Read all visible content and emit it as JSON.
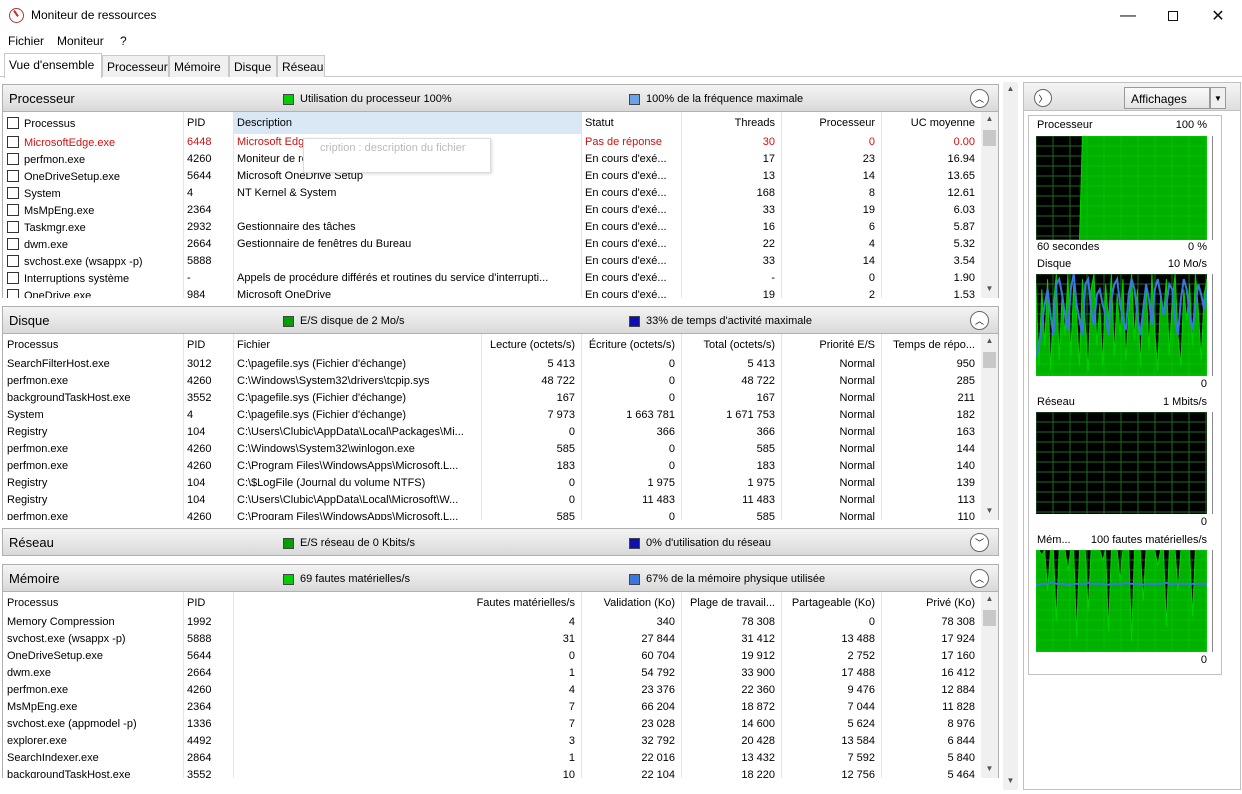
{
  "window": {
    "title": "Moniteur de ressources",
    "minimize": "—",
    "close": "✕"
  },
  "menu": [
    "Fichier",
    "Moniteur",
    "?"
  ],
  "tabs": [
    "Vue d'ensemble",
    "Processeur",
    "Mémoire",
    "Disque",
    "Réseau"
  ],
  "colors": {
    "green": "#00d000",
    "blue": "#3a78e0",
    "darkblue": "#1010b0",
    "graph_bg": "#000000",
    "graph_grid": "#1f6b1f"
  },
  "processeur": {
    "title": "Processeur",
    "ind1": "Utilisation du processeur 100%",
    "ind2": "100% de la fréquence maximale",
    "columns": [
      "Processus",
      "PID",
      "Description",
      "Statut",
      "Threads",
      "Processeur",
      "UC moyenne"
    ],
    "tooltip": "cription : description du fichier",
    "rows": [
      [
        "MicrosoftEdge.exe",
        "6448",
        "Microsoft Edge",
        "Pas de réponse",
        "30",
        "0",
        "0.00"
      ],
      [
        "perfmon.exe",
        "4260",
        "Moniteur de ressources et de performances",
        "En cours d'exé...",
        "17",
        "23",
        "16.94"
      ],
      [
        "OneDriveSetup.exe",
        "5644",
        "Microsoft OneDrive Setup",
        "En cours d'exé...",
        "13",
        "14",
        "13.65"
      ],
      [
        "System",
        "4",
        "NT Kernel & System",
        "En cours d'exé...",
        "168",
        "8",
        "12.61"
      ],
      [
        "MsMpEng.exe",
        "2364",
        "",
        "En cours d'exé...",
        "33",
        "19",
        "6.03"
      ],
      [
        "Taskmgr.exe",
        "2932",
        "Gestionnaire des tâches",
        "En cours d'exé...",
        "16",
        "6",
        "5.87"
      ],
      [
        "dwm.exe",
        "2664",
        "Gestionnaire de fenêtres du Bureau",
        "En cours d'exé...",
        "22",
        "4",
        "5.32"
      ],
      [
        "svchost.exe (wsappx -p)",
        "5888",
        "",
        "En cours d'exé...",
        "33",
        "14",
        "3.54"
      ],
      [
        "Interruptions système",
        "-",
        "Appels de procédure différés et routines du service d'interrupti...",
        "En cours d'exé...",
        "-",
        "0",
        "1.90"
      ],
      [
        "OneDrive.exe",
        "984",
        "Microsoft OneDrive",
        "En cours d'exé...",
        "19",
        "2",
        "1.53"
      ]
    ]
  },
  "disque": {
    "title": "Disque",
    "ind1": "E/S disque de 2 Mo/s",
    "ind2": "33% de temps d'activité maximale",
    "columns": [
      "Processus",
      "PID",
      "Fichier",
      "Lecture (octets/s)",
      "Écriture (octets/s)",
      "Total (octets/s)",
      "Priorité E/S",
      "Temps de répo..."
    ],
    "rows": [
      [
        "SearchFilterHost.exe",
        "3012",
        "C:\\pagefile.sys (Fichier d'échange)",
        "5 413",
        "0",
        "5 413",
        "Normal",
        "950"
      ],
      [
        "perfmon.exe",
        "4260",
        "C:\\Windows\\System32\\drivers\\tcpip.sys",
        "48 722",
        "0",
        "48 722",
        "Normal",
        "285"
      ],
      [
        "backgroundTaskHost.exe",
        "3552",
        "C:\\pagefile.sys (Fichier d'échange)",
        "167",
        "0",
        "167",
        "Normal",
        "211"
      ],
      [
        "System",
        "4",
        "C:\\pagefile.sys (Fichier d'échange)",
        "7 973",
        "1 663 781",
        "1 671 753",
        "Normal",
        "182"
      ],
      [
        "Registry",
        "104",
        "C:\\Users\\Clubic\\AppData\\Local\\Packages\\Mi...",
        "0",
        "366",
        "366",
        "Normal",
        "163"
      ],
      [
        "perfmon.exe",
        "4260",
        "C:\\Windows\\System32\\winlogon.exe",
        "585",
        "0",
        "585",
        "Normal",
        "144"
      ],
      [
        "perfmon.exe",
        "4260",
        "C:\\Program Files\\WindowsApps\\Microsoft.L...",
        "183",
        "0",
        "183",
        "Normal",
        "140"
      ],
      [
        "Registry",
        "104",
        "C:\\$LogFile (Journal du volume NTFS)",
        "0",
        "1 975",
        "1 975",
        "Normal",
        "139"
      ],
      [
        "Registry",
        "104",
        "C:\\Users\\Clubic\\AppData\\Local\\Microsoft\\W...",
        "0",
        "11 483",
        "11 483",
        "Normal",
        "113"
      ],
      [
        "perfmon.exe",
        "4260",
        "C:\\Program Files\\WindowsApps\\Microsoft.L...",
        "585",
        "0",
        "585",
        "Normal",
        "110"
      ]
    ]
  },
  "reseau": {
    "title": "Réseau",
    "ind1": "E/S réseau de 0 Kbits/s",
    "ind2": "0% d'utilisation du réseau"
  },
  "memoire": {
    "title": "Mémoire",
    "ind1": "69 fautes matérielles/s",
    "ind2": "67% de la mémoire physique utilisée",
    "columns": [
      "Processus",
      "PID",
      "Fautes matérielles/s",
      "Validation (Ko)",
      "Plage de travail...",
      "Partageable (Ko)",
      "Privé (Ko)"
    ],
    "rows": [
      [
        "Memory Compression",
        "1992",
        "4",
        "340",
        "78 308",
        "0",
        "78 308"
      ],
      [
        "svchost.exe (wsappx -p)",
        "5888",
        "31",
        "27 844",
        "31 412",
        "13 488",
        "17 924"
      ],
      [
        "OneDriveSetup.exe",
        "5644",
        "0",
        "60 704",
        "19 912",
        "2 752",
        "17 160"
      ],
      [
        "dwm.exe",
        "2664",
        "1",
        "54 792",
        "33 900",
        "17 488",
        "16 412"
      ],
      [
        "perfmon.exe",
        "4260",
        "4",
        "23 376",
        "22 360",
        "9 476",
        "12 884"
      ],
      [
        "MsMpEng.exe",
        "2364",
        "7",
        "66 204",
        "18 872",
        "7 044",
        "11 828"
      ],
      [
        "svchost.exe (appmodel -p)",
        "1336",
        "7",
        "23 028",
        "14 600",
        "5 624",
        "8 976"
      ],
      [
        "explorer.exe",
        "4492",
        "3",
        "32 792",
        "20 428",
        "13 584",
        "6 844"
      ],
      [
        "SearchIndexer.exe",
        "2864",
        "1",
        "22 016",
        "13 432",
        "7 592",
        "5 840"
      ],
      [
        "backgroundTaskHost.exe",
        "3552",
        "10",
        "22 104",
        "18 220",
        "12 756",
        "5 464"
      ]
    ]
  },
  "right_pane": {
    "view_button": "Affichages",
    "graphs": [
      {
        "name": "Processeur",
        "max": "100 %",
        "footer_left": "60 secondes",
        "footer_right": "0 %"
      },
      {
        "name": "Disque",
        "max": "10 Mo/s",
        "footer_right": "0"
      },
      {
        "name": "Réseau",
        "max": "1 Mbits/s",
        "footer_right": "0"
      },
      {
        "name": "Mém...",
        "max": "100 fautes matérielles/s",
        "footer_right": "0"
      }
    ],
    "series": {
      "cpu": [
        0,
        0,
        0,
        0,
        0,
        0,
        0,
        0,
        0,
        0,
        0,
        0,
        0,
        0,
        0,
        0,
        100,
        100,
        100,
        100,
        100,
        100,
        100,
        100,
        100,
        100,
        100,
        100,
        100,
        100,
        100,
        100,
        100,
        100,
        100,
        100,
        100,
        100,
        100,
        100,
        100,
        100,
        100,
        100,
        100,
        100,
        100,
        100,
        100,
        100,
        100,
        100,
        100,
        100,
        100,
        100,
        100,
        100,
        100,
        100
      ],
      "disk_green": [
        90,
        10,
        85,
        30,
        95,
        5,
        70,
        100,
        15,
        80,
        40,
        100,
        20,
        90,
        60,
        10,
        95,
        50,
        5,
        85,
        100,
        30,
        70,
        10,
        90,
        55,
        100,
        20,
        80,
        40,
        95,
        15,
        60,
        100,
        35,
        85,
        10,
        70,
        90,
        25,
        100,
        45,
        5,
        80,
        60,
        95,
        20,
        75,
        100,
        40,
        10,
        85,
        55,
        90,
        30,
        100,
        65,
        15,
        80,
        95
      ],
      "disk_blue": [
        20,
        30,
        50,
        70,
        85,
        60,
        40,
        90,
        95,
        80,
        60,
        45,
        85,
        100,
        70,
        55,
        40,
        90,
        95,
        65,
        50,
        80,
        85,
        70,
        60,
        40,
        75,
        90,
        95,
        70,
        55,
        45,
        80,
        95,
        85,
        60,
        40,
        65,
        90,
        75,
        50,
        85,
        95,
        80,
        60,
        70,
        90,
        85,
        55,
        40,
        75,
        95,
        85,
        60,
        45,
        70,
        90,
        80,
        65,
        85
      ],
      "mem_green": [
        100,
        100,
        95,
        100,
        60,
        100,
        100,
        30,
        100,
        100,
        100,
        80,
        100,
        100,
        15,
        100,
        100,
        100,
        40,
        100,
        100,
        100,
        100,
        90,
        100,
        20,
        100,
        100,
        100,
        70,
        100,
        100,
        100,
        10,
        100,
        100,
        100,
        50,
        100,
        100,
        100,
        100,
        85,
        100,
        100,
        25,
        100,
        100,
        100,
        60,
        100,
        100,
        100,
        100,
        35,
        100,
        100,
        100,
        100,
        100
      ],
      "mem_blue": [
        66,
        66,
        67,
        67,
        67,
        68,
        68,
        67,
        67,
        67,
        67,
        66,
        66,
        67,
        67,
        67,
        67,
        67,
        68,
        67,
        67,
        67,
        67,
        67,
        66,
        66,
        67,
        67,
        67,
        67,
        67,
        68,
        67,
        67,
        67,
        67,
        67,
        66,
        67,
        67,
        67,
        67,
        67,
        67,
        67,
        68,
        67,
        67,
        67,
        67,
        67,
        67,
        67,
        66,
        67,
        67,
        67,
        67,
        67,
        67
      ]
    }
  }
}
